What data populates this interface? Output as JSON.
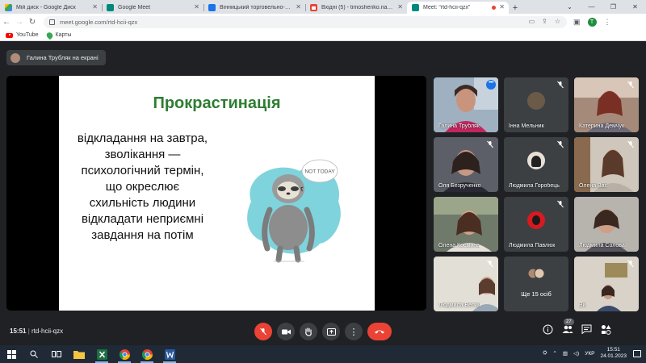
{
  "browser": {
    "tabs": [
      {
        "title": "Мій диск - Google Диск",
        "favicon_color": "#fbbc04"
      },
      {
        "title": "Google Meet",
        "favicon_color": "#00897b"
      },
      {
        "title": "Вінницький торговельно-еконо…",
        "favicon_color": "#1a73e8"
      },
      {
        "title": "Вхідні (5) - timoshenko.natalia@…",
        "favicon_color": "#ea4335"
      },
      {
        "title": "Meet: “rtd-hcii-qzx”",
        "favicon_color": "#00897b",
        "active": true
      }
    ],
    "url": "meet.google.com/rtd-hcii-qzx",
    "profile_initial": "T",
    "bookmarks": [
      {
        "label": "YouTube",
        "icon": "youtube-icon"
      },
      {
        "label": "Карты",
        "icon": "maps-icon"
      }
    ]
  },
  "meet": {
    "presenting_label": "Галина Трубляк на екрані",
    "slide": {
      "title": "Прокрастинація",
      "body_lines": [
        "відкладання на завтра,",
        "зволікання —",
        "психологічний термін,",
        "що окреслює",
        "схильність людини",
        "відкладати неприємні",
        "завдання на потім"
      ],
      "bubble_text": "NOT TODAY"
    },
    "participants": [
      {
        "name": "Галина Трубляк",
        "speaking": true
      },
      {
        "name": "Інна Мельник"
      },
      {
        "name": "Катерина Демчук"
      },
      {
        "name": "Оля Безрученко"
      },
      {
        "name": "Людмила Горобець"
      },
      {
        "name": "Олена Вас"
      },
      {
        "name": "Олена Космина"
      },
      {
        "name": "Людмила Павлюк"
      },
      {
        "name": "Людмила Солова"
      },
      {
        "name": "Людмила Велич"
      },
      {
        "name": "Ще 15 осіб"
      },
      {
        "name": "Ви"
      }
    ],
    "time": "15:51",
    "meeting_code": "rtd-hcii-qzx",
    "participants_count": "27",
    "colors": {
      "accent": "#8ab4f8",
      "danger": "#ea4335",
      "slide_title": "#2e7d32"
    }
  },
  "taskbar": {
    "lang": "УКР",
    "time": "15:51",
    "date": "24.01.2023"
  }
}
